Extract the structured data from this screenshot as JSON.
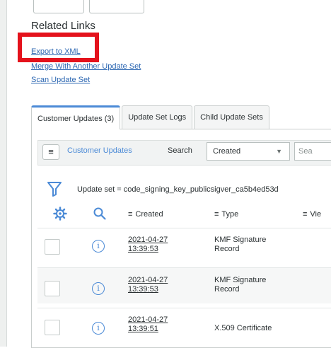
{
  "related_links": {
    "title": "Related Links",
    "items": [
      {
        "label": "Export to XML"
      },
      {
        "label": "Merge With Another Update Set"
      },
      {
        "label": "Scan Update Set"
      }
    ]
  },
  "tabs": [
    {
      "label": "Customer Updates (3)",
      "active": true
    },
    {
      "label": "Update Set Logs",
      "active": false
    },
    {
      "label": "Child Update Sets",
      "active": false
    }
  ],
  "list": {
    "name": "Customer Updates",
    "search_label": "Search",
    "search_field": "Created",
    "search_placeholder": "Sea",
    "filter_text": "Update set = code_signing_key_publicsigver_ca5b4ed53d"
  },
  "columns": {
    "created": "Created",
    "type": "Type",
    "view": "Vie"
  },
  "rows": [
    {
      "created_date": "2021-04-27",
      "created_time": "13:39:53",
      "type_line1": "KMF Signature",
      "type_line2": "Record"
    },
    {
      "created_date": "2021-04-27",
      "created_time": "13:39:53",
      "type_line1": "KMF Signature",
      "type_line2": "Record"
    },
    {
      "created_date": "2021-04-27",
      "created_time": "13:39:51",
      "type_line1": "X.509 Certificate",
      "type_line2": ""
    }
  ],
  "icons": {
    "menu": "hamburger-icon",
    "filter": "funnel-icon",
    "settings": "gear-icon",
    "search": "magnifier-icon",
    "info": "info-icon"
  },
  "colors": {
    "accent": "#4b8ad6",
    "link": "#2c67b2",
    "highlight": "#e4121c"
  }
}
